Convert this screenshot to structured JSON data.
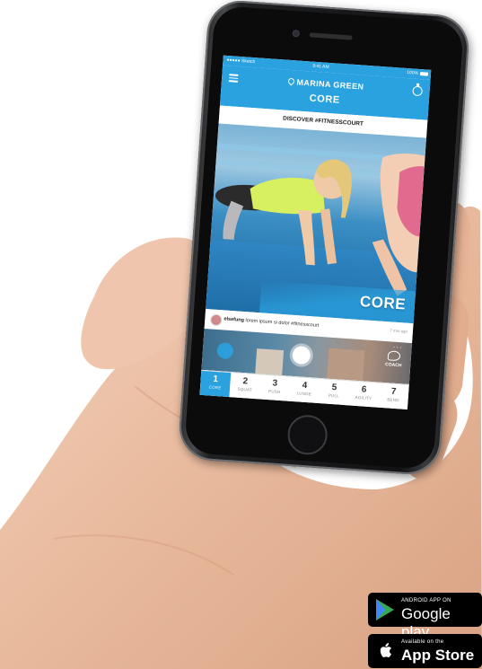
{
  "status_bar": {
    "carrier": "●●●●● Sketch",
    "time": "9:41 AM",
    "battery": "100%"
  },
  "header": {
    "location": "MARINA GREEN",
    "title": "CORE",
    "menu_icon": "menu-icon",
    "timer_icon": "timer-icon"
  },
  "banner": {
    "text": "DISCOVER #FITNESSCOURT"
  },
  "hero": {
    "label": "CORE"
  },
  "feed": {
    "username": "elsefung",
    "text": "lorem ipsum si dolor #fitnesscourt",
    "time": "7 min ago"
  },
  "video": {
    "coach_label": "COACH",
    "more": "···"
  },
  "tabs": [
    {
      "num": "1",
      "label": "CORE"
    },
    {
      "num": "2",
      "label": "SQUAT"
    },
    {
      "num": "3",
      "label": "PUSH"
    },
    {
      "num": "4",
      "label": "LUNGE"
    },
    {
      "num": "5",
      "label": "PULL"
    },
    {
      "num": "6",
      "label": "AGILITY"
    },
    {
      "num": "7",
      "label": "BEND"
    }
  ],
  "active_tab": 0,
  "stores": {
    "google": {
      "small": "ANDROID APP ON",
      "big": "Google play"
    },
    "apple": {
      "small": "Available on the",
      "big": "App Store"
    }
  },
  "colors": {
    "accent": "#2aa2e0",
    "badge_bg": "#000000"
  }
}
